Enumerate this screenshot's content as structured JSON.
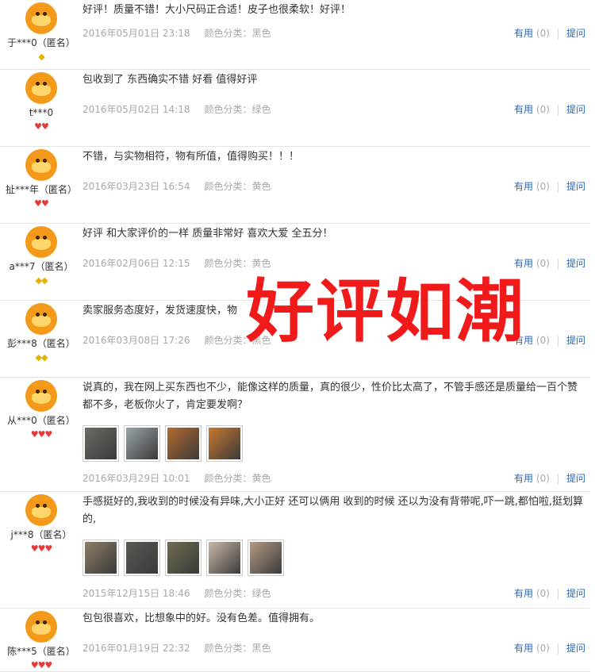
{
  "labels": {
    "useful": "有用",
    "reply": "提问",
    "color_prefix": "颜色分类："
  },
  "reviews": [
    {
      "user": "于***0（匿名）",
      "badge": "gold",
      "text": "好评！质量不错！大小尺码正合适！皮子也很柔软！好评！",
      "date": "2016年05月01日 23:18",
      "color": "黑色",
      "useful_count": "(0)",
      "images": []
    },
    {
      "user": "t***0",
      "badge": "red",
      "text": "包收到了 东西确实不错 好看 值得好评",
      "date": "2016年05月02日 14:18",
      "color": "绿色",
      "useful_count": "(0)",
      "images": []
    },
    {
      "user": "扯***年（匿名）",
      "badge": "red",
      "text": "不错，与实物相符，物有所值，值得购买！！！",
      "date": "2016年03月23日 16:54",
      "color": "黄色",
      "useful_count": "(0)",
      "images": []
    },
    {
      "user": "a***7（匿名）",
      "badge": "gold",
      "text": "好评 和大家评价的一样 质量非常好 喜欢大爱 全五分！",
      "date": "2016年02月06日 12:15",
      "color": "黄色",
      "useful_count": "(0)",
      "images": []
    },
    {
      "user": "彭***8（匿名）",
      "badge": "gold",
      "text": "卖家服务态度好，发货速度快，物",
      "date": "2016年03月08日 17:26",
      "color": "黑色",
      "useful_count": "(0)",
      "images": []
    },
    {
      "user": "从***0（匿名）",
      "badge": "red",
      "text": "说真的，我在网上买东西也不少，能像这样的质量，真的很少，性价比太高了，不管手感还是质量给一百个赞都不多，老板你火了，肯定要发啊？",
      "date": "2016年03月29日 10:01",
      "color": "黄色",
      "useful_count": "(0)",
      "images": [
        "#6d6a62",
        "#9aa3a8",
        "#b46a2e",
        "#c8782e"
      ]
    },
    {
      "user": "j***8（匿名）",
      "badge": "red",
      "text": "手感挺好的,我收到的时候没有异味,大小正好 还可以俩用 收到的时候 还以为没有背带呢,吓一跳,都怕啦,挺划算的,",
      "date": "2015年12月15日 18:46",
      "color": "绿色",
      "useful_count": "(0)",
      "images": [
        "#8e7d66",
        "#5a5852",
        "#6e6b4e",
        "#c9b8a6",
        "#b49a84"
      ]
    },
    {
      "user": "陈***5（匿名）",
      "badge": "red",
      "text": "包包很喜欢，比想象中的好。没有色差。值得拥有。",
      "date": "2016年01月19日 22:32",
      "color": "黑色",
      "useful_count": "(0)",
      "images": []
    }
  ],
  "overlay_text": "好评如潮"
}
